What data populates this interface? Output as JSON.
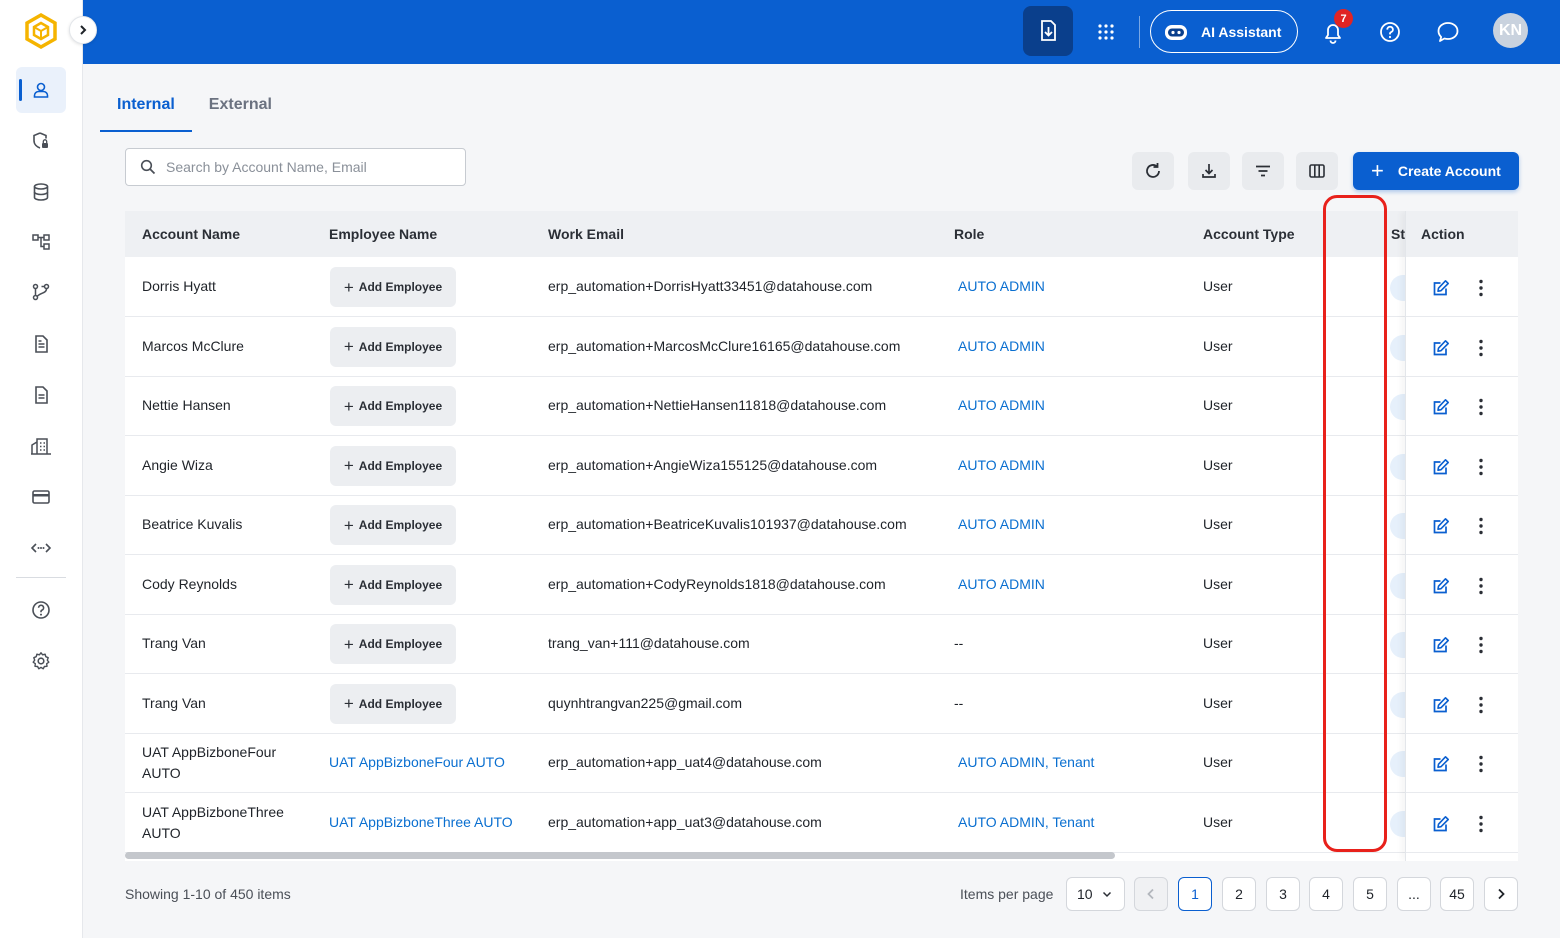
{
  "topbar": {
    "ai_assistant_label": "AI Assistant",
    "notification_count": "7",
    "avatar_initials": "KN"
  },
  "tabs": [
    {
      "label": "Internal",
      "active": true
    },
    {
      "label": "External",
      "active": false
    }
  ],
  "search": {
    "placeholder": "Search by Account Name, Email",
    "value": ""
  },
  "toolbar": {
    "create_label": "Create Account"
  },
  "table": {
    "headers": {
      "account_name": "Account Name",
      "employee_name": "Employee Name",
      "work_email": "Work Email",
      "role": "Role",
      "account_type": "Account Type",
      "status": "St",
      "action": "Action"
    },
    "add_employee_label": "Add Employee",
    "rows": [
      {
        "account_name": [
          "Dorris Hyatt"
        ],
        "employee": null,
        "email": "erp_automation+DorrisHyatt33451@datahouse.com",
        "role": "AUTO ADMIN",
        "account_type": "User"
      },
      {
        "account_name": [
          "Marcos McClure"
        ],
        "employee": null,
        "email": "erp_automation+MarcosMcClure16165@datahouse.com",
        "role": "AUTO ADMIN",
        "account_type": "User"
      },
      {
        "account_name": [
          "Nettie Hansen"
        ],
        "employee": null,
        "email": "erp_automation+NettieHansen11818@datahouse.com",
        "role": "AUTO ADMIN",
        "account_type": "User"
      },
      {
        "account_name": [
          "Angie Wiza"
        ],
        "employee": null,
        "email": "erp_automation+AngieWiza155125@datahouse.com",
        "role": "AUTO ADMIN",
        "account_type": "User"
      },
      {
        "account_name": [
          "Beatrice Kuvalis"
        ],
        "employee": null,
        "email": "erp_automation+BeatriceKuvalis101937@datahouse.com",
        "role": "AUTO ADMIN",
        "account_type": "User"
      },
      {
        "account_name": [
          "Cody Reynolds"
        ],
        "employee": null,
        "email": "erp_automation+CodyReynolds1818@datahouse.com",
        "role": "AUTO ADMIN",
        "account_type": "User"
      },
      {
        "account_name": [
          "Trang Van"
        ],
        "employee": null,
        "email": "trang_van+111@datahouse.com",
        "role": "--",
        "account_type": "User"
      },
      {
        "account_name": [
          "Trang Van"
        ],
        "employee": null,
        "email": "quynhtrangvan225@gmail.com",
        "role": "--",
        "account_type": "User"
      },
      {
        "account_name": [
          "UAT AppBizboneFour",
          "AUTO"
        ],
        "employee": "UAT AppBizboneFour AUTO",
        "email": "erp_automation+app_uat4@datahouse.com",
        "role": "AUTO ADMIN, Tenant",
        "account_type": "User"
      },
      {
        "account_name": [
          "UAT AppBizboneThree",
          "AUTO"
        ],
        "employee": "UAT AppBizboneThree AUTO",
        "email": "erp_automation+app_uat3@datahouse.com",
        "role": "AUTO ADMIN, Tenant",
        "account_type": "User"
      }
    ]
  },
  "footer": {
    "showing": "Showing 1-10 of 450 items",
    "items_per_page_label": "Items per page",
    "items_per_page_value": "10",
    "pages": [
      "1",
      "2",
      "3",
      "4",
      "5",
      "...",
      "45"
    ],
    "current_page": "1"
  },
  "colors": {
    "primary": "#0a5fd0",
    "highlight": "#e8211b",
    "link": "#0a6fd0"
  }
}
